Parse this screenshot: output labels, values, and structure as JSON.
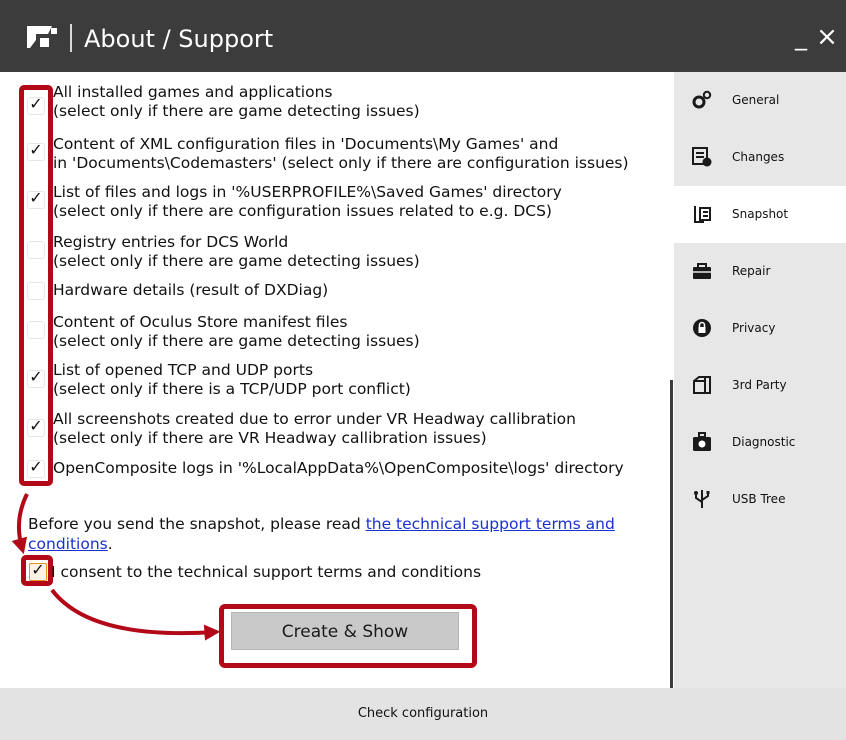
{
  "window": {
    "title": "About / Support",
    "minimize_label": "_",
    "close_label": "×"
  },
  "options": [
    {
      "line1": "All installed games and applications",
      "line2": "(select only if there are game detecting issues)",
      "checked": true
    },
    {
      "line1": "Content of XML configuration files in 'Documents\\My Games' and",
      "line2": "in 'Documents\\Codemasters' (select only if there are configuration issues)",
      "checked": true
    },
    {
      "line1": "List of files and logs in '%USERPROFILE%\\Saved Games' directory",
      "line2": "(select only if there are configuration issues related to e.g. DCS)",
      "checked": true
    },
    {
      "line1": "Registry entries for DCS World",
      "line2": "(select only if there are game detecting issues)",
      "checked": false
    },
    {
      "line1": "Hardware details (result of DXDiag)",
      "line2": "",
      "checked": false
    },
    {
      "line1": "Content of Oculus Store manifest files",
      "line2": "(select only if there are game detecting issues)",
      "checked": false
    },
    {
      "line1": "List of opened TCP and UDP ports",
      "line2": "(select only if there is a TCP/UDP port conflict)",
      "checked": true
    },
    {
      "line1": "All screenshots created due to error under VR Headway callibration",
      "line2": "(select only if there are VR Headway callibration issues)",
      "checked": true
    },
    {
      "line1": "OpenComposite logs in '%LocalAppData%\\OpenComposite\\logs' directory",
      "line2": "",
      "checked": true
    }
  ],
  "check_mark": "✓",
  "notice": {
    "prefix": "Before you send the snapshot, please read ",
    "link_part1": "the technical support terms and",
    "link_part2": "conditions",
    "suffix": "."
  },
  "consent": {
    "label": "I consent to the technical support terms and conditions",
    "checked": true
  },
  "create_button": {
    "label": "Create & Show"
  },
  "sidebar": {
    "items": [
      {
        "label": "General",
        "icon": "gears-icon",
        "active": false
      },
      {
        "label": "Changes",
        "icon": "changes-icon",
        "active": false
      },
      {
        "label": "Snapshot",
        "icon": "snapshot-icon",
        "active": true
      },
      {
        "label": "Repair",
        "icon": "toolbox-icon",
        "active": false
      },
      {
        "label": "Privacy",
        "icon": "lock-icon",
        "active": false
      },
      {
        "label": "3rd Party",
        "icon": "box-icon",
        "active": false
      },
      {
        "label": "Diagnostic",
        "icon": "diagnostic-icon",
        "active": false
      },
      {
        "label": "USB Tree",
        "icon": "usb-icon",
        "active": false
      }
    ]
  },
  "footer": {
    "label": "Check configuration"
  },
  "colors": {
    "titlebar": "#3c3c3c",
    "sidebar": "#e7e7e7",
    "annotation": "#b20818",
    "link": "#1a31d0",
    "consent_border": "#ee8f1e"
  }
}
